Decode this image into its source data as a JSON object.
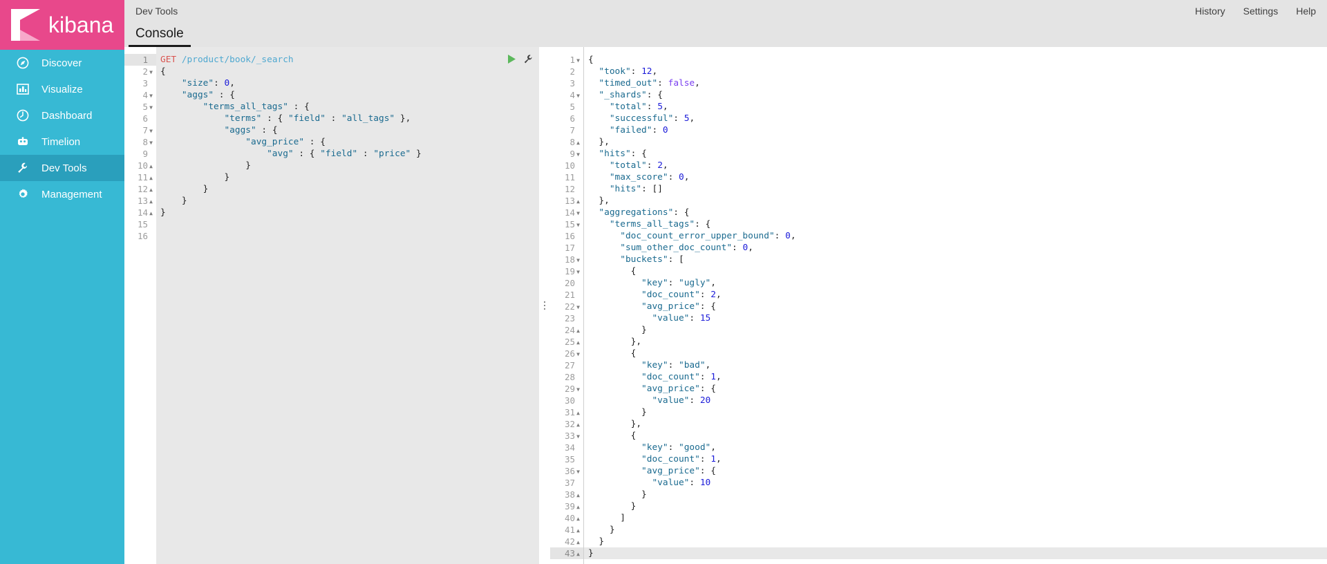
{
  "brand": {
    "name": "kibana"
  },
  "sidebar": {
    "items": [
      {
        "label": "Discover",
        "icon": "compass-icon",
        "active": false
      },
      {
        "label": "Visualize",
        "icon": "bar-chart-icon",
        "active": false
      },
      {
        "label": "Dashboard",
        "icon": "dashboard-icon",
        "active": false
      },
      {
        "label": "Timelion",
        "icon": "timelion-icon",
        "active": false
      },
      {
        "label": "Dev Tools",
        "icon": "wrench-icon",
        "active": true
      },
      {
        "label": "Management",
        "icon": "gear-icon",
        "active": false
      }
    ]
  },
  "topbar": {
    "title": "Dev Tools",
    "links": [
      "History",
      "Settings",
      "Help"
    ]
  },
  "tabs": [
    {
      "label": "Console",
      "active": true
    }
  ],
  "editor": {
    "actions": [
      {
        "name": "send-request-button",
        "icon": "play-icon",
        "color": "#5cb85c"
      },
      {
        "name": "settings-wrench-button",
        "icon": "wrench-icon",
        "color": "#3f3f3f"
      }
    ],
    "request": {
      "method": "GET",
      "path": "/product/book/_search",
      "lines": [
        {
          "n": 1,
          "fold": "none",
          "cur": true,
          "text": "GET /product/book/_search"
        },
        {
          "n": 2,
          "fold": "open",
          "cur": false,
          "text": "{"
        },
        {
          "n": 3,
          "fold": "none",
          "cur": false,
          "text": "    \"size\": 0,"
        },
        {
          "n": 4,
          "fold": "open",
          "cur": false,
          "text": "    \"aggs\" : {"
        },
        {
          "n": 5,
          "fold": "open",
          "cur": false,
          "text": "        \"terms_all_tags\" : {"
        },
        {
          "n": 6,
          "fold": "none",
          "cur": false,
          "text": "            \"terms\" : { \"field\" : \"all_tags\" },"
        },
        {
          "n": 7,
          "fold": "open",
          "cur": false,
          "text": "            \"aggs\" : {"
        },
        {
          "n": 8,
          "fold": "open",
          "cur": false,
          "text": "                \"avg_price\" : {"
        },
        {
          "n": 9,
          "fold": "none",
          "cur": false,
          "text": "                    \"avg\" : { \"field\" : \"price\" }"
        },
        {
          "n": 10,
          "fold": "close",
          "cur": false,
          "text": "                }"
        },
        {
          "n": 11,
          "fold": "close",
          "cur": false,
          "text": "            }"
        },
        {
          "n": 12,
          "fold": "close",
          "cur": false,
          "text": "        }"
        },
        {
          "n": 13,
          "fold": "close",
          "cur": false,
          "text": "    }"
        },
        {
          "n": 14,
          "fold": "close",
          "cur": false,
          "text": "}"
        },
        {
          "n": 15,
          "fold": "none",
          "cur": false,
          "text": ""
        },
        {
          "n": 16,
          "fold": "none",
          "cur": false,
          "text": ""
        }
      ]
    },
    "response": {
      "took": 12,
      "timed_out": "false",
      "_shards": {
        "total": 5,
        "successful": 5,
        "failed": 0
      },
      "hits": {
        "total": 2,
        "max_score": 0,
        "hits": "[]"
      },
      "aggregations": {
        "terms_all_tags": {
          "doc_count_error_upper_bound": 0,
          "sum_other_doc_count": 0,
          "buckets": [
            {
              "key": "ugly",
              "doc_count": 2,
              "avg_price": {
                "value": 15
              }
            },
            {
              "key": "bad",
              "doc_count": 1,
              "avg_price": {
                "value": 20
              }
            },
            {
              "key": "good",
              "doc_count": 1,
              "avg_price": {
                "value": 10
              }
            }
          ]
        }
      },
      "lines": [
        {
          "n": 1,
          "fold": "open",
          "cur": false,
          "text": "{"
        },
        {
          "n": 2,
          "fold": "none",
          "cur": false,
          "text": "  \"took\": 12,"
        },
        {
          "n": 3,
          "fold": "none",
          "cur": false,
          "text": "  \"timed_out\": false,"
        },
        {
          "n": 4,
          "fold": "open",
          "cur": false,
          "text": "  \"_shards\": {"
        },
        {
          "n": 5,
          "fold": "none",
          "cur": false,
          "text": "    \"total\": 5,"
        },
        {
          "n": 6,
          "fold": "none",
          "cur": false,
          "text": "    \"successful\": 5,"
        },
        {
          "n": 7,
          "fold": "none",
          "cur": false,
          "text": "    \"failed\": 0"
        },
        {
          "n": 8,
          "fold": "close",
          "cur": false,
          "text": "  },"
        },
        {
          "n": 9,
          "fold": "open",
          "cur": false,
          "text": "  \"hits\": {"
        },
        {
          "n": 10,
          "fold": "none",
          "cur": false,
          "text": "    \"total\": 2,"
        },
        {
          "n": 11,
          "fold": "none",
          "cur": false,
          "text": "    \"max_score\": 0,"
        },
        {
          "n": 12,
          "fold": "none",
          "cur": false,
          "text": "    \"hits\": []"
        },
        {
          "n": 13,
          "fold": "close",
          "cur": false,
          "text": "  },"
        },
        {
          "n": 14,
          "fold": "open",
          "cur": false,
          "text": "  \"aggregations\": {"
        },
        {
          "n": 15,
          "fold": "open",
          "cur": false,
          "text": "    \"terms_all_tags\": {"
        },
        {
          "n": 16,
          "fold": "none",
          "cur": false,
          "text": "      \"doc_count_error_upper_bound\": 0,"
        },
        {
          "n": 17,
          "fold": "none",
          "cur": false,
          "text": "      \"sum_other_doc_count\": 0,"
        },
        {
          "n": 18,
          "fold": "open",
          "cur": false,
          "text": "      \"buckets\": ["
        },
        {
          "n": 19,
          "fold": "open",
          "cur": false,
          "text": "        {"
        },
        {
          "n": 20,
          "fold": "none",
          "cur": false,
          "text": "          \"key\": \"ugly\","
        },
        {
          "n": 21,
          "fold": "none",
          "cur": false,
          "text": "          \"doc_count\": 2,"
        },
        {
          "n": 22,
          "fold": "open",
          "cur": false,
          "text": "          \"avg_price\": {"
        },
        {
          "n": 23,
          "fold": "none",
          "cur": false,
          "text": "            \"value\": 15"
        },
        {
          "n": 24,
          "fold": "close",
          "cur": false,
          "text": "          }"
        },
        {
          "n": 25,
          "fold": "close",
          "cur": false,
          "text": "        },"
        },
        {
          "n": 26,
          "fold": "open",
          "cur": false,
          "text": "        {"
        },
        {
          "n": 27,
          "fold": "none",
          "cur": false,
          "text": "          \"key\": \"bad\","
        },
        {
          "n": 28,
          "fold": "none",
          "cur": false,
          "text": "          \"doc_count\": 1,"
        },
        {
          "n": 29,
          "fold": "open",
          "cur": false,
          "text": "          \"avg_price\": {"
        },
        {
          "n": 30,
          "fold": "none",
          "cur": false,
          "text": "            \"value\": 20"
        },
        {
          "n": 31,
          "fold": "close",
          "cur": false,
          "text": "          }"
        },
        {
          "n": 32,
          "fold": "close",
          "cur": false,
          "text": "        },"
        },
        {
          "n": 33,
          "fold": "open",
          "cur": false,
          "text": "        {"
        },
        {
          "n": 34,
          "fold": "none",
          "cur": false,
          "text": "          \"key\": \"good\","
        },
        {
          "n": 35,
          "fold": "none",
          "cur": false,
          "text": "          \"doc_count\": 1,"
        },
        {
          "n": 36,
          "fold": "open",
          "cur": false,
          "text": "          \"avg_price\": {"
        },
        {
          "n": 37,
          "fold": "none",
          "cur": false,
          "text": "            \"value\": 10"
        },
        {
          "n": 38,
          "fold": "close",
          "cur": false,
          "text": "          }"
        },
        {
          "n": 39,
          "fold": "close",
          "cur": false,
          "text": "        }"
        },
        {
          "n": 40,
          "fold": "close",
          "cur": false,
          "text": "      ]"
        },
        {
          "n": 41,
          "fold": "close",
          "cur": false,
          "text": "    }"
        },
        {
          "n": 42,
          "fold": "close",
          "cur": false,
          "text": "  }"
        },
        {
          "n": 43,
          "fold": "close",
          "cur": true,
          "text": "}"
        }
      ]
    }
  }
}
